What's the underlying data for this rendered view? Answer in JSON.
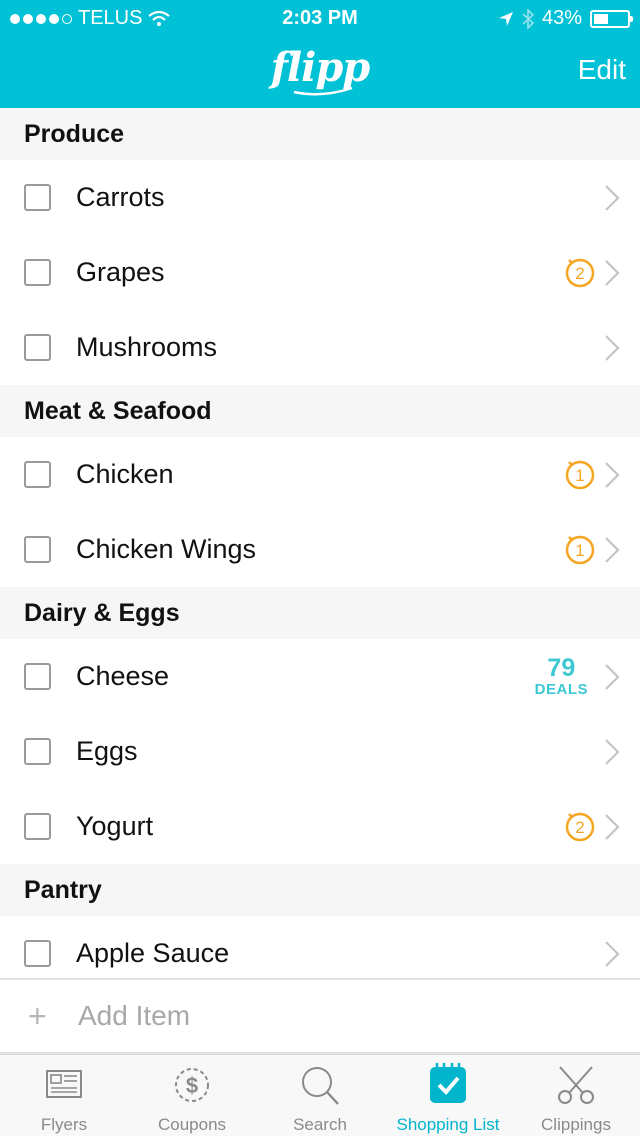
{
  "status_bar": {
    "carrier": "TELUS",
    "time": "2:03 PM",
    "battery": "43%",
    "battery_level": 0.43
  },
  "nav": {
    "logo": "flipp",
    "edit_label": "Edit"
  },
  "sections": [
    {
      "title": "Produce",
      "items": [
        {
          "label": "Carrots"
        },
        {
          "label": "Grapes",
          "badge": "2"
        },
        {
          "label": "Mushrooms"
        }
      ]
    },
    {
      "title": "Meat & Seafood",
      "items": [
        {
          "label": "Chicken",
          "badge": "1"
        },
        {
          "label": "Chicken Wings",
          "badge": "1"
        }
      ]
    },
    {
      "title": "Dairy & Eggs",
      "items": [
        {
          "label": "Cheese",
          "deals_count": "79",
          "deals_label": "DEALS"
        },
        {
          "label": "Eggs"
        },
        {
          "label": "Yogurt",
          "badge": "2"
        }
      ]
    },
    {
      "title": "Pantry",
      "items": [
        {
          "label": "Apple Sauce"
        }
      ]
    }
  ],
  "add_item": {
    "placeholder": "Add Item"
  },
  "tabs": [
    {
      "label": "Flyers",
      "icon": "flyers-icon"
    },
    {
      "label": "Coupons",
      "icon": "coupons-icon"
    },
    {
      "label": "Search",
      "icon": "search-icon"
    },
    {
      "label": "Shopping List",
      "icon": "shopping-list-icon",
      "active": true
    },
    {
      "label": "Clippings",
      "icon": "clippings-icon"
    }
  ],
  "colors": {
    "brand": "#00c1d6",
    "badge": "#f5a623",
    "deals": "#3cc8d4"
  }
}
